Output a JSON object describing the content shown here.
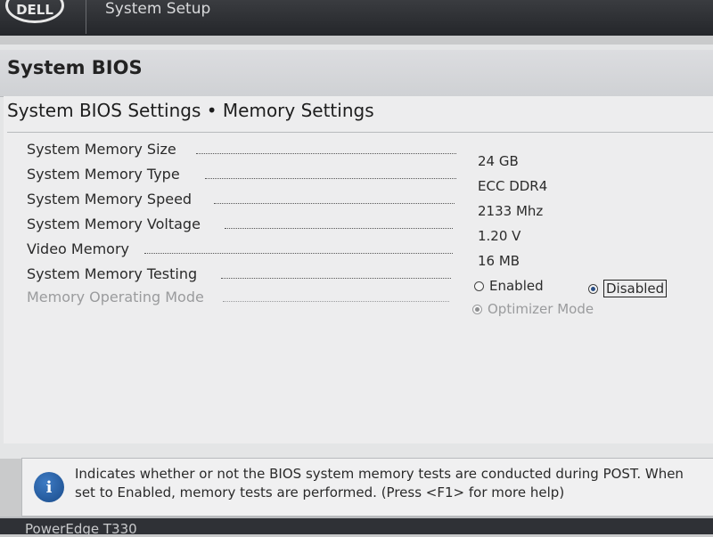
{
  "header": {
    "logo_text": "DELL",
    "title": "System Setup"
  },
  "section": {
    "title": "System BIOS"
  },
  "settings": {
    "title": "System BIOS Settings • Memory Settings",
    "rows": [
      {
        "label": "System Memory Size",
        "value": "24 GB"
      },
      {
        "label": "System Memory Type",
        "value": "ECC DDR4"
      },
      {
        "label": "System Memory Speed",
        "value": "2133 Mhz"
      },
      {
        "label": "System Memory Voltage",
        "value": "1.20 V"
      },
      {
        "label": "Video Memory",
        "value": "16 MB"
      }
    ],
    "memory_testing": {
      "label": "System Memory Testing",
      "options": [
        {
          "label": "Enabled",
          "selected": false
        },
        {
          "label": "Disabled",
          "selected": true
        }
      ]
    },
    "operating_mode": {
      "label": "Memory Operating Mode",
      "option": {
        "label": "Optimizer Mode",
        "selected": true
      },
      "enabled": false
    }
  },
  "help": {
    "icon": "info-icon",
    "text": "Indicates whether or not the BIOS system memory tests are conducted during POST. When set to Enabled, memory tests are performed. (Press <F1> for more help)"
  },
  "footer": {
    "model": "PowerEdge T330"
  },
  "colors": {
    "header_bg": "#2c2e32",
    "panel_bg": "#ededee",
    "info_blue": "#1f5a9e",
    "disabled_text": "#9a9b9d"
  }
}
